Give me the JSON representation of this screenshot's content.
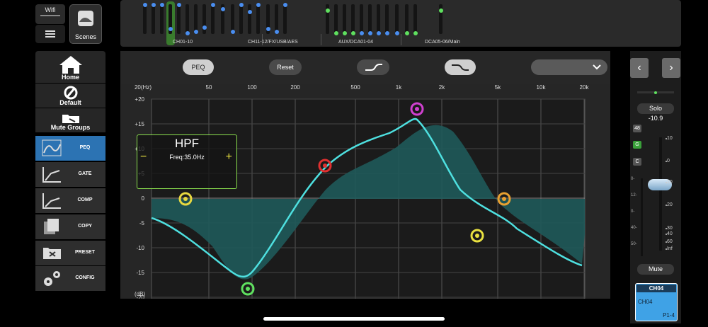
{
  "top": {
    "wifi_label": "Wifi",
    "scenes_label": "Scenes"
  },
  "strip": {
    "groups": [
      "CH01-10",
      "CH11-12/FX/USB/AES",
      "AUX/DCA01-04",
      "DCA05-06/Main"
    ]
  },
  "nav": {
    "home": "Home",
    "default": "Default",
    "mute_groups": "Mute Groups",
    "tools": [
      "PEQ",
      "GATE",
      "COMP",
      "COPY",
      "PRESET",
      "CONFIG"
    ]
  },
  "peq": {
    "peq_button": "PEQ",
    "reset_button": "Reset",
    "dropdown_value": "",
    "freq_labels": [
      "20(Hz)",
      "50",
      "100",
      "200",
      "500",
      "1k",
      "2k",
      "5k",
      "10k",
      "20k"
    ],
    "db_labels": [
      "+20",
      "+15",
      "+10",
      "+5",
      "0",
      "-5",
      "-10",
      "-15",
      "-20"
    ],
    "db_unit": "(dB)",
    "popup": {
      "title": "HPF",
      "value": "Freq:35.0Hz",
      "minus": "−",
      "plus": "+"
    }
  },
  "channel": {
    "solo": "Solo",
    "gain": "-10.9",
    "buttons": [
      "48",
      "G",
      "C"
    ],
    "scale_right": [
      "10",
      "0",
      "10",
      "20",
      "30",
      "40",
      "60",
      "Inf"
    ],
    "scale_left": [
      "0-",
      "12-",
      "0-",
      "40-",
      "50-"
    ],
    "mute": "Mute",
    "strip_title": "CH04",
    "strip_name": "CH04",
    "strip_input": "P1-4"
  },
  "colors": {
    "accent_blue": "#2c73b3",
    "curve": "#4ee0e0",
    "fill": "#1f5a5a",
    "popup_border": "#8be04e"
  }
}
